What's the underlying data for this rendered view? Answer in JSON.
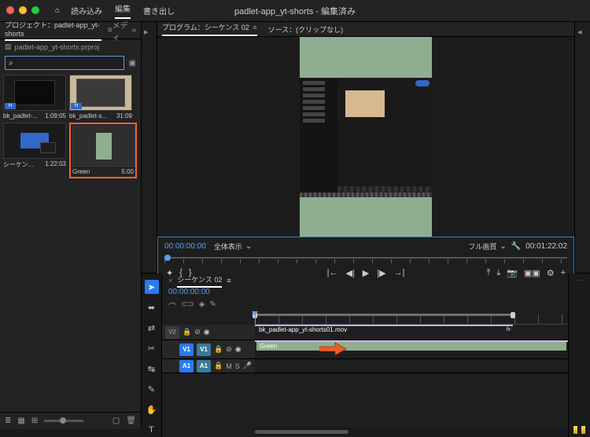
{
  "app": {
    "title_project": "padlet-app_yt-shorts",
    "title_suffix": " - 編集済み",
    "tabs": {
      "import": "読み込み",
      "edit": "編集",
      "export": "書き出し"
    }
  },
  "project": {
    "tab": "プロジェクト：padlet-app_yt-shorts",
    "media_tab": "メディ",
    "filename": "padlet-app_yt-shorts.prproj",
    "search_placeholder": "",
    "bins": [
      {
        "name": "bk_padlet-...",
        "dur": "1:09:05"
      },
      {
        "name": "bk_padlet-s...",
        "dur": "31:09"
      },
      {
        "name": "シーケン...",
        "dur": "1:22:03"
      },
      {
        "name": "Green",
        "dur": "5:00"
      }
    ]
  },
  "program": {
    "tab": "プログラム：シーケンス 02",
    "source_tab": "ソース：(クリップなし)",
    "tc_left": "00:00:00:00",
    "fit": "全体表示",
    "quality": "フル画質",
    "tc_right": "00:01:22:02"
  },
  "timeline": {
    "tab": "シーケンス 02",
    "tc": "00:00:00:00",
    "v2_label": "V2",
    "v1_target": "V1",
    "v1_label": "V1",
    "a1_target": "A1",
    "a1_label": "A1",
    "clip_v2": "bk_padlet-app_yt-shorts01.mov",
    "clip_v1": "Green",
    "icons": {
      "snap": "⌒",
      "link": "⊂⊃",
      "marker": "◈",
      "wrench": "✎"
    }
  },
  "icons": {
    "home": "⌂",
    "menu": "≡",
    "search": "⌕",
    "folder": "▣",
    "list": "≣",
    "freeform": "▦",
    "newitem": "▢",
    "trash": "🗑",
    "chev": "⌄",
    "wrench": "🔧",
    "mark_in": "{",
    "mark_out": "}",
    "go_in": "|←",
    "go_out": "→|",
    "step_back": "◀|",
    "play": "▶",
    "step_fwd": "|▶",
    "lift": "⤒",
    "extract": "⤓",
    "export_frame": "⎙",
    "camera": "📷",
    "compare": "▣▣",
    "settings": "⚙",
    "plus": "+",
    "sel": "▲",
    "track_sel": "↔",
    "ripple": "⟷",
    "razor": "✂",
    "slip": "↹",
    "pen": "✎",
    "hand": "✋",
    "type": "T",
    "lock": "🔒",
    "eye": "◉",
    "mute": "M",
    "solo": "S",
    "rec": "●",
    "aud": "🔊"
  }
}
